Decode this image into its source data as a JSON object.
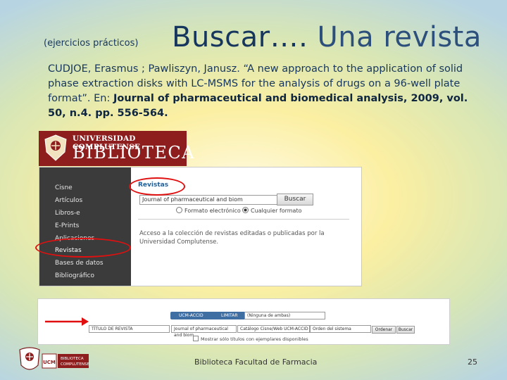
{
  "slide": {
    "subtitle": "(ejercicios prácticos)",
    "title_part1": "Buscar….",
    "title_part2": " Una revista",
    "citation_plain": "CUDJOE, Erasmus ; Pawliszyn, Janusz. “A new approach to the application of solid phase extraction disks with LC-MSMS for the analysis of drugs on a 96-well plate format”. En: ",
    "citation_bold": "Journal of pharmaceutical and biomedical analysis, 2009, vol. 50, n.4. pp. 556-564."
  },
  "banner": {
    "university": "UNIVERSIDAD COMPLUTENSE",
    "library": "BIBLIOTECA"
  },
  "search_panel": {
    "nav_items": [
      "Cisne",
      "Artículos",
      "Libros-e",
      "E-Prints",
      "Aplicaciones",
      "Revistas",
      "Bases de datos",
      "Bibliográfico"
    ],
    "active_tab": "Revistas",
    "input_value": "Journal of pharmaceutical and biom",
    "search_button": "Buscar",
    "radio_electronic": "Formato electrónico",
    "radio_any": "Cualquier formato",
    "info_text": "Acceso a la colección de revistas editadas o publicadas por la Universidad Complutense."
  },
  "catalog_strip": {
    "btn_ucm": "UCM-ACCID",
    "btn_limitar": "LIMITAR",
    "select_placeholder": "(Ninguna de ambas)",
    "field_select": "TÍTULO DE REVISTA",
    "query_value": "Journal of pharmaceutical and biom",
    "catalog_select": "Catálogo Cisne/Web UCM-ACCID",
    "sort_select": "Orden del sistema",
    "order_button": "Ordenar",
    "search_button": "Buscar",
    "checkbox_label": "Mostrar sólo títulos con ejemplares disponibles"
  },
  "footer": {
    "logo_text1": "BIBLIOTECA",
    "logo_text2": "COMPLUTENSE",
    "caption": "Biblioteca Facultad de Farmacia",
    "page_number": "25"
  },
  "colors": {
    "title_color": "#17365d",
    "annotation_red": "#e01010",
    "banner_red": "#8e1d1d",
    "sidebar_dark": "#3b3b3b"
  }
}
